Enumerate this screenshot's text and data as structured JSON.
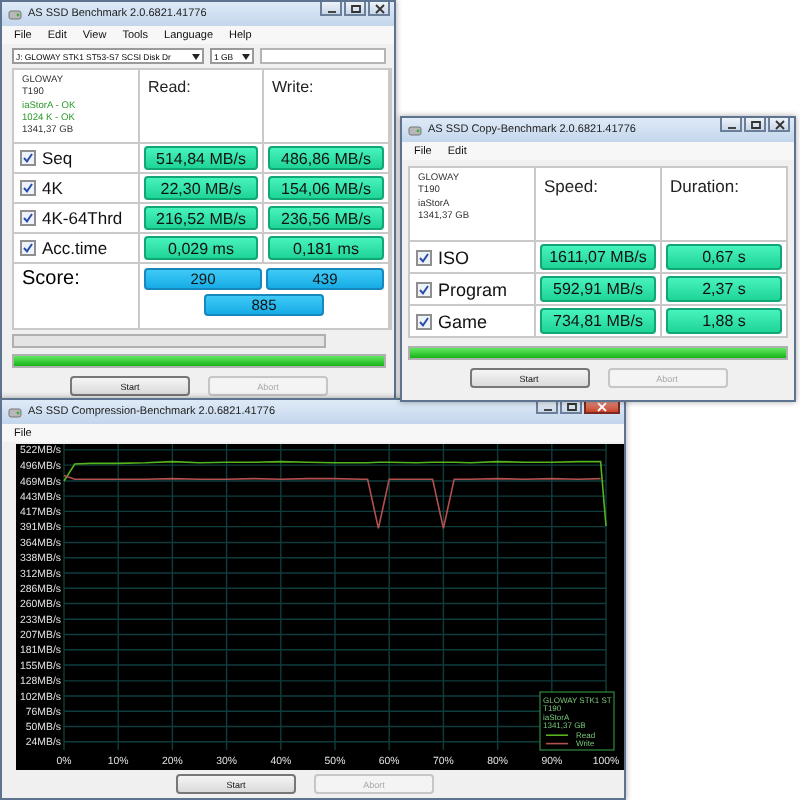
{
  "benchmark_window": {
    "title": "AS SSD Benchmark 2.0.6821.41776",
    "active": false,
    "menu": [
      "File",
      "Edit",
      "View",
      "Tools",
      "Language",
      "Help"
    ],
    "drive": "J: GLOWAY STK1 ST53-S7 SCSI Disk Dr",
    "size": "1 GB",
    "info": [
      {
        "text": "GLOWAY",
        "ok": false
      },
      {
        "text": "T190",
        "ok": false
      },
      {
        "text": "iaStorA - OK",
        "ok": true
      },
      {
        "text": "1024 K - OK",
        "ok": true
      },
      {
        "text": "1341,37 GB",
        "ok": false
      }
    ],
    "columns": [
      "Read:",
      "Write:"
    ],
    "rows": [
      {
        "label": "Seq",
        "checked": true,
        "read": "514,84 MB/s",
        "write": "486,86 MB/s"
      },
      {
        "label": "4K",
        "checked": true,
        "read": "22,30 MB/s",
        "write": "154,06 MB/s"
      },
      {
        "label": "4K-64Thrd",
        "checked": true,
        "read": "216,52 MB/s",
        "write": "236,56 MB/s"
      },
      {
        "label": "Acc.time",
        "checked": true,
        "read": "0,029 ms",
        "write": "0,181 ms"
      }
    ],
    "score_label": "Score:",
    "scores": {
      "read": "290",
      "write": "439",
      "total": "885"
    },
    "progress": [
      {
        "level": 0
      },
      {
        "level": 1
      }
    ],
    "buttons": [
      {
        "label": "Start",
        "disabled": false
      },
      {
        "label": "Abort",
        "disabled": true
      }
    ]
  },
  "copy_window": {
    "title": "AS SSD Copy-Benchmark 2.0.6821.41776",
    "active": false,
    "menu": [
      "File",
      "Edit"
    ],
    "info": [
      "GLOWAY",
      "T190",
      "iaStorA",
      "1341,37 GB"
    ],
    "columns": [
      "Speed:",
      "Duration:"
    ],
    "rows": [
      {
        "label": "ISO",
        "checked": true,
        "speed": "1611,07 MB/s",
        "duration": "0,67 s"
      },
      {
        "label": "Program",
        "checked": true,
        "speed": "592,91 MB/s",
        "duration": "2,37 s"
      },
      {
        "label": "Game",
        "checked": true,
        "speed": "734,81 MB/s",
        "duration": "1,88 s"
      }
    ],
    "progress": {
      "level": 1
    },
    "buttons": [
      {
        "label": "Start",
        "disabled": false
      },
      {
        "label": "Abort",
        "disabled": true
      }
    ]
  },
  "compression_window": {
    "title": "AS SSD Compression-Benchmark 2.0.6821.41776",
    "active": true,
    "menu": [
      "File"
    ],
    "chart_data": {
      "type": "line",
      "ylim": [
        10,
        532
      ],
      "xlim": [
        0,
        100
      ],
      "grid": true,
      "legend": true,
      "x": [
        0,
        2,
        5,
        10,
        15,
        20,
        25,
        30,
        35,
        40,
        45,
        50,
        55,
        56,
        58,
        60,
        65,
        68,
        70,
        72,
        75,
        80,
        85,
        90,
        95,
        99,
        100
      ],
      "series": [
        {
          "name": "Read",
          "color": "#55b31c",
          "values": [
            469,
            498,
            499,
            499,
            500,
            502,
            500,
            501,
            501,
            502,
            501,
            500,
            500,
            500,
            501,
            501,
            500,
            501,
            501,
            501,
            500,
            502,
            501,
            501,
            502,
            502,
            392
          ]
        },
        {
          "name": "Write",
          "color": "#b45050",
          "values": [
            478,
            472,
            472,
            472,
            472,
            473,
            472,
            472,
            473,
            472,
            473,
            473,
            472,
            472,
            388,
            472,
            472,
            472,
            388,
            472,
            472,
            473,
            472,
            473,
            472,
            473,
            null
          ]
        }
      ],
      "yticks": [
        {
          "value": 522,
          "label": "522MB/s"
        },
        {
          "value": 496,
          "label": "496MB/s"
        },
        {
          "value": 469,
          "label": "469MB/s"
        },
        {
          "value": 443,
          "label": "443MB/s"
        },
        {
          "value": 417,
          "label": "417MB/s"
        },
        {
          "value": 391,
          "label": "391MB/s"
        },
        {
          "value": 364,
          "label": "364MB/s"
        },
        {
          "value": 338,
          "label": "338MB/s"
        },
        {
          "value": 312,
          "label": "312MB/s"
        },
        {
          "value": 286,
          "label": "286MB/s"
        },
        {
          "value": 260,
          "label": "260MB/s"
        },
        {
          "value": 233,
          "label": "233MB/s"
        },
        {
          "value": 207,
          "label": "207MB/s"
        },
        {
          "value": 181,
          "label": "181MB/s"
        },
        {
          "value": 155,
          "label": "155MB/s"
        },
        {
          "value": 128,
          "label": "128MB/s"
        },
        {
          "value": 102,
          "label": "102MB/s"
        },
        {
          "value": 76,
          "label": "76MB/s"
        },
        {
          "value": 50,
          "label": "50MB/s"
        },
        {
          "value": 24,
          "label": "24MB/s"
        }
      ],
      "xticks": [
        {
          "value": 0,
          "label": "0%"
        },
        {
          "value": 10,
          "label": "10%"
        },
        {
          "value": 20,
          "label": "20%"
        },
        {
          "value": 30,
          "label": "30%"
        },
        {
          "value": 40,
          "label": "40%"
        },
        {
          "value": 50,
          "label": "50%"
        },
        {
          "value": 60,
          "label": "60%"
        },
        {
          "value": 70,
          "label": "70%"
        },
        {
          "value": 80,
          "label": "80%"
        },
        {
          "value": 90,
          "label": "90%"
        },
        {
          "value": 100,
          "label": "100%"
        }
      ]
    },
    "legend_info": [
      "GLOWAY STK1 ST",
      "T190",
      "iaStorA",
      "1341,37 GB"
    ],
    "buttons": [
      {
        "label": "Start",
        "disabled": false
      },
      {
        "label": "Abort",
        "disabled": true
      }
    ]
  }
}
